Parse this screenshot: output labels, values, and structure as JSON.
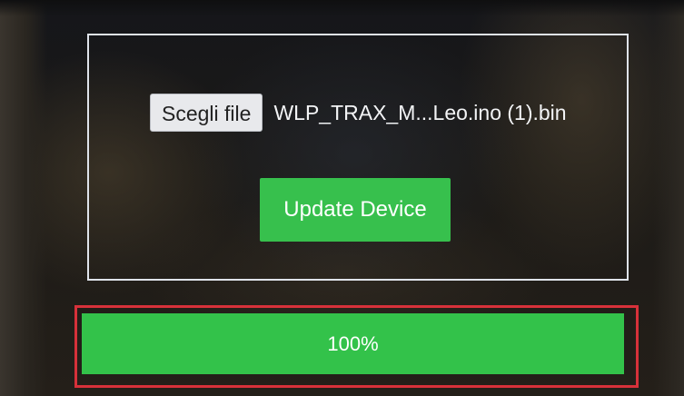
{
  "upload_form": {
    "choose_file_label": "Scegli file",
    "selected_file_name": "WLP_TRAX_M...Leo.ino (1).bin",
    "update_button_label": "Update Device"
  },
  "progress": {
    "label": "100%",
    "percent": 100
  },
  "colors": {
    "accent_green": "#37c04d",
    "highlight_red": "#d7313a",
    "panel_border": "#dfe3ea"
  }
}
